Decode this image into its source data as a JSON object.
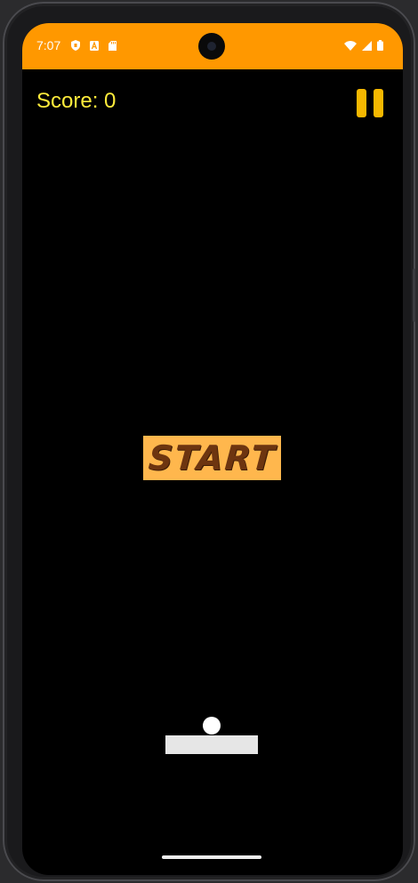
{
  "status_bar": {
    "time": "7:07",
    "background_color": "#ff9800",
    "left_icons": [
      "shield-icon",
      "a-letter-icon",
      "sd-card-icon"
    ],
    "right_icons": [
      "wifi-icon",
      "cell-signal-icon",
      "battery-icon"
    ]
  },
  "game": {
    "score_label": "Score: 0",
    "start_label": "START",
    "colors": {
      "background": "#000000",
      "score_text": "#ffeb3b",
      "pause_button": "#f5b800",
      "start_button": "#ffb74d",
      "start_text": "#6d3510",
      "ball": "#ffffff",
      "paddle": "#e6e6e6"
    }
  }
}
